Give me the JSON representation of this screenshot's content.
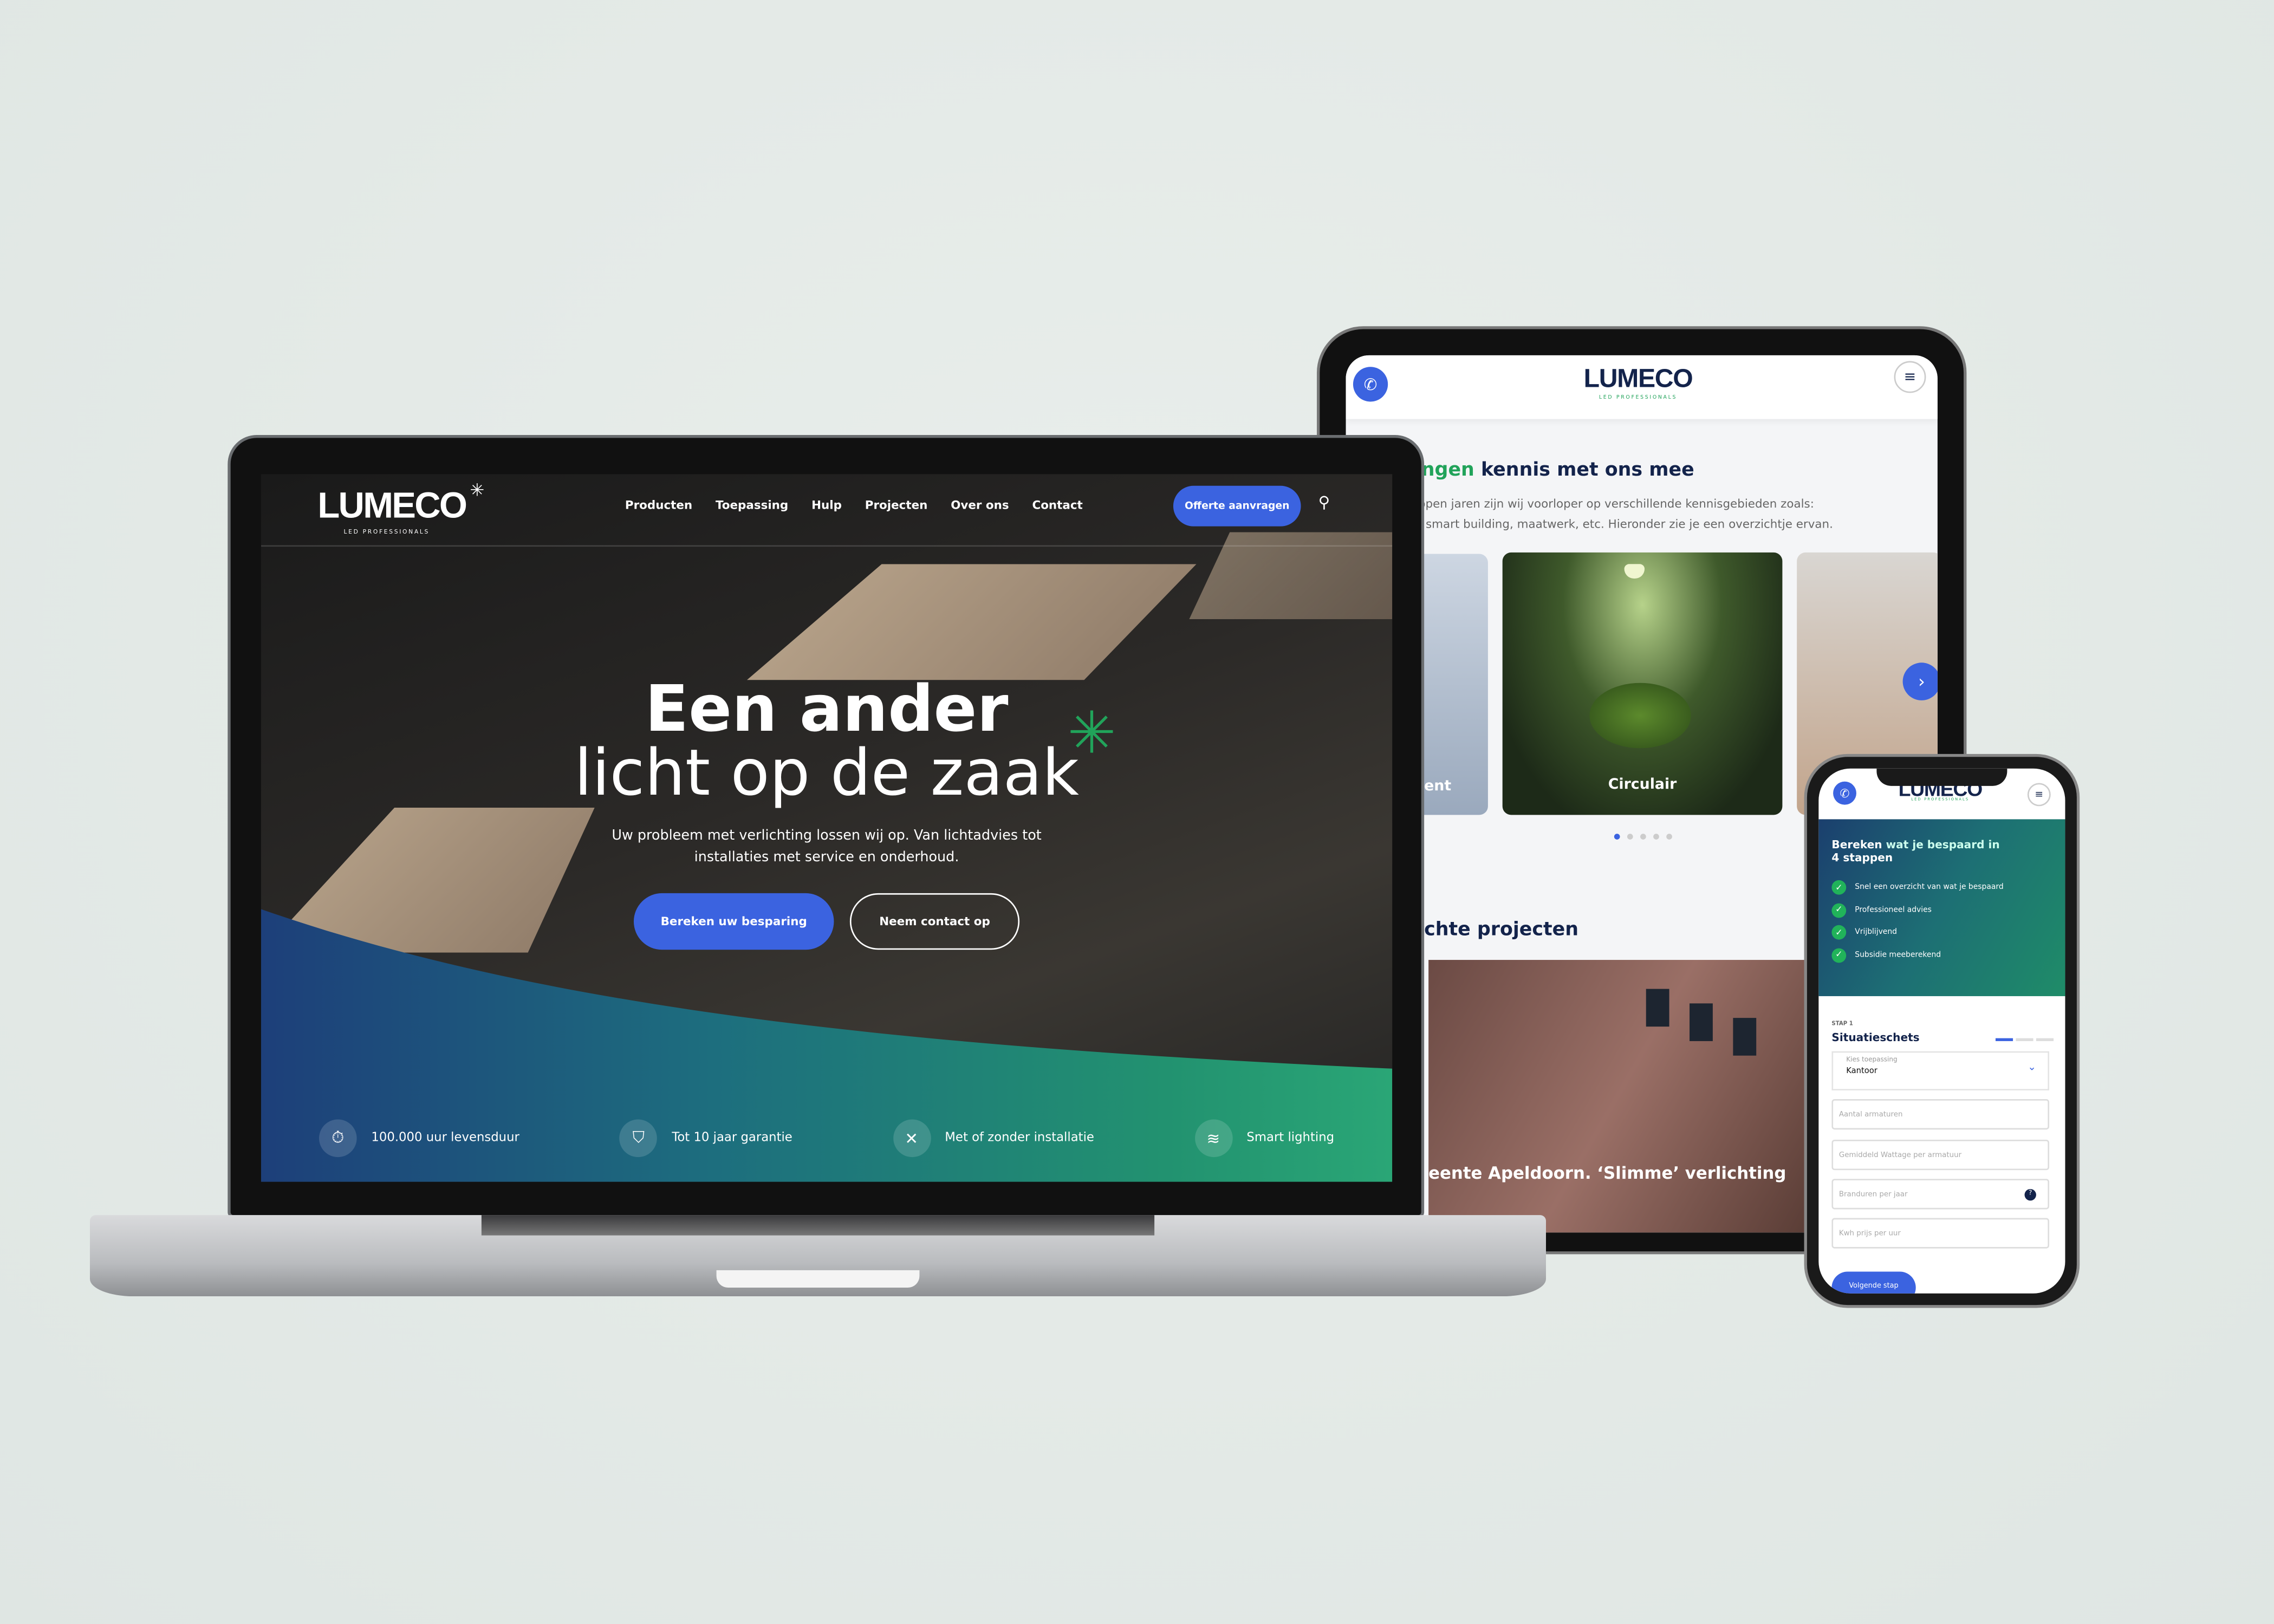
{
  "colors": {
    "accent_blue": "#3b63e0",
    "brand_green": "#21a35a",
    "navy": "#13234b",
    "teal": "#1d7a74"
  },
  "laptop": {
    "logo": "LUMECO",
    "logo_sub": "LED PROFESSIONALS",
    "nav": [
      "Producten",
      "Toepassing",
      "Hulp",
      "Projecten",
      "Over ons",
      "Contact"
    ],
    "cta": "Offerte aanvragen",
    "search_icon": "search-icon",
    "hero": {
      "line1": "Een ander",
      "line2": "licht op de zaak",
      "sub1": "Uw probleem met verlichting lossen wij op. Van lichtadvies tot",
      "sub2": "installaties met service en onderhoud."
    },
    "buttons": {
      "primary": "Bereken uw besparing",
      "secondary": "Neem contact op"
    },
    "features": [
      {
        "icon": "stopwatch-icon",
        "label": "100.000 uur levensduur"
      },
      {
        "icon": "shield-icon",
        "label": "Tot 10 jaar garantie"
      },
      {
        "icon": "tools-icon",
        "label": "Met of zonder installatie"
      },
      {
        "icon": "wifi-icon",
        "label": "Smart lighting"
      }
    ]
  },
  "tablet": {
    "logo": "LUMECO",
    "logo_sub": "LED PROFESSIONALS",
    "heading_green": "ngen",
    "heading_rest": " kennis met ons mee",
    "text1": "open jaren zijn wij voorloper op verschillende kennisgebieden zoals:",
    "text2": ", smart building, maatwerk, etc. Hieronder zie je een overzichtje ervan.",
    "cards": [
      {
        "label": "ent"
      },
      {
        "label": "Circulair"
      }
    ],
    "carousel_dots": 5,
    "carousel_active": 1,
    "projects_heading": "chte projecten",
    "project_caption": "eente Apeldoorn. ‘Slimme’ verlichting"
  },
  "phone": {
    "logo": "LUMECO",
    "logo_sub": "LED PROFESSIONALS",
    "heading_bold": "Bereken",
    "heading_rest": " wat je bespaard in",
    "heading_line2": "4 stappen",
    "checks": [
      "Snel een overzicht van wat je bespaard",
      "Professioneel advies",
      "Vrijblijvend",
      "Subsidie meeberekend"
    ],
    "step_label": "STAP 1",
    "step_title": "Situatieschets",
    "step_progress": "1/3",
    "select": {
      "label": "Kies toepassing",
      "value": "Kantoor"
    },
    "inputs": [
      {
        "placeholder": "Aantal armaturen"
      },
      {
        "placeholder": "Gemiddeld Wattage per armatuur"
      },
      {
        "placeholder": "Branduren per jaar",
        "help": "?"
      },
      {
        "placeholder": "Kwh prijs per uur"
      }
    ],
    "next_button": "Volgende stap"
  }
}
